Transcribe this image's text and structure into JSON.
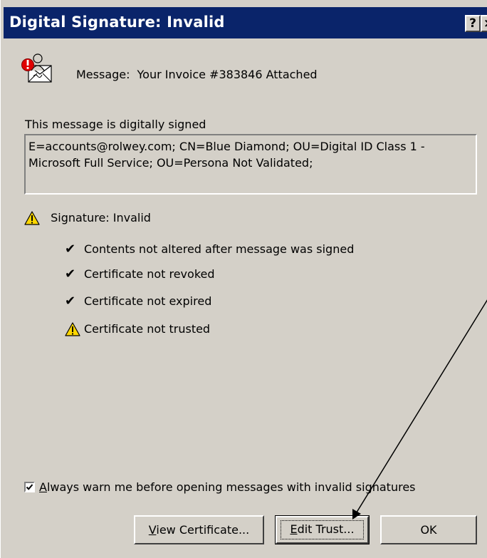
{
  "window": {
    "title": "Digital Signature: Invalid",
    "help_label": "?",
    "close_label": "×"
  },
  "message": {
    "label": "Message:",
    "subject": "Your Invoice #383846 Attached",
    "icon": "signed-message-warning-icon"
  },
  "signed_label": "This message is digitally signed",
  "certificate": {
    "line1": "E=accounts@rolwey.com; CN=Blue Diamond; OU=Digital ID Class 1 -",
    "line2": "Microsoft Full Service; OU=Persona Not Validated;"
  },
  "signature_status": {
    "label": "Signature: Invalid",
    "icon": "warning-icon"
  },
  "checks": [
    {
      "label": "Contents not altered after message was signed",
      "icon": "checkmark-icon"
    },
    {
      "label": "Certificate not revoked",
      "icon": "checkmark-icon"
    },
    {
      "label": "Certificate not expired",
      "icon": "checkmark-icon"
    },
    {
      "label": "Certificate not trusted",
      "icon": "warning-icon"
    }
  ],
  "warn_checkbox": {
    "mnemonic": "A",
    "label_rest": "lways warn me before opening messages with invalid signatures",
    "checked": true
  },
  "buttons": {
    "view_certificate": {
      "mnemonic": "V",
      "rest": "iew Certificate..."
    },
    "edit_trust": {
      "mnemonic": "E",
      "rest": "dit Trust..."
    },
    "ok": "OK"
  },
  "colors": {
    "dialog_bg": "#d4d0c8",
    "titlebar_bg": "#0a246a",
    "warning_yellow": "#ffd700"
  }
}
